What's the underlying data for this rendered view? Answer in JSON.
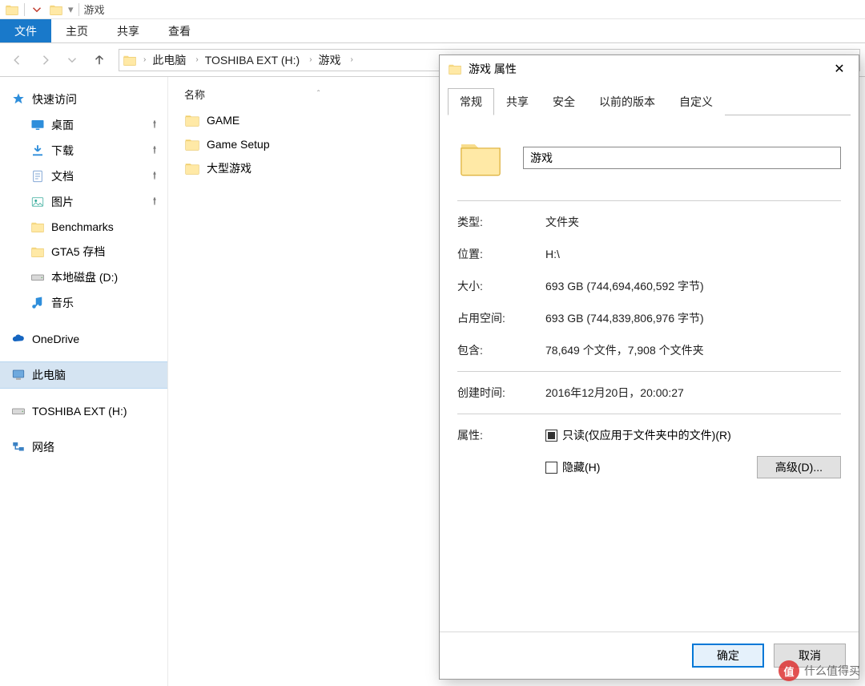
{
  "window": {
    "title": "游戏"
  },
  "ribbon": {
    "file": "文件",
    "tabs": [
      "主页",
      "共享",
      "查看"
    ]
  },
  "breadcrumb": {
    "items": [
      "此电脑",
      "TOSHIBA EXT (H:)",
      "游戏"
    ]
  },
  "columns": {
    "name": "名称"
  },
  "nav": {
    "quick_access": "快速访问",
    "children": [
      {
        "label": "桌面",
        "icon": "desktop-icon",
        "pinned": true
      },
      {
        "label": "下载",
        "icon": "download-icon",
        "pinned": true
      },
      {
        "label": "文档",
        "icon": "documents-icon",
        "pinned": true
      },
      {
        "label": "图片",
        "icon": "pictures-icon",
        "pinned": true
      },
      {
        "label": "Benchmarks",
        "icon": "folder-icon",
        "pinned": false
      },
      {
        "label": "GTA5 存档",
        "icon": "folder-icon",
        "pinned": false
      },
      {
        "label": "本地磁盘 (D:)",
        "icon": "drive-icon",
        "pinned": false
      },
      {
        "label": "音乐",
        "icon": "music-icon",
        "pinned": false
      }
    ],
    "onedrive": "OneDrive",
    "this_pc": "此电脑",
    "toshiba": "TOSHIBA EXT (H:)",
    "network": "网络"
  },
  "files": [
    {
      "name": "GAME"
    },
    {
      "name": "Game Setup"
    },
    {
      "name": "大型游戏"
    }
  ],
  "dialog": {
    "title": "游戏 属性",
    "tabs": [
      "常规",
      "共享",
      "安全",
      "以前的版本",
      "自定义"
    ],
    "name_value": "游戏",
    "rows": {
      "type_label": "类型:",
      "type_value": "文件夹",
      "loc_label": "位置:",
      "loc_value": "H:\\",
      "size_label": "大小:",
      "size_value": "693 GB (744,694,460,592 字节)",
      "disk_label": "占用空间:",
      "disk_value": "693 GB (744,839,806,976 字节)",
      "contains_label": "包含:",
      "contains_value": "78,649 个文件，7,908 个文件夹",
      "created_label": "创建时间:",
      "created_value": "2016年12月20日，20:00:27",
      "attr_label": "属性:"
    },
    "readonly": "只读(仅应用于文件夹中的文件)(R)",
    "hidden": "隐藏(H)",
    "advanced": "高级(D)...",
    "ok": "确定",
    "cancel": "取消"
  },
  "watermark": {
    "badge": "值",
    "text": "什么值得买"
  }
}
